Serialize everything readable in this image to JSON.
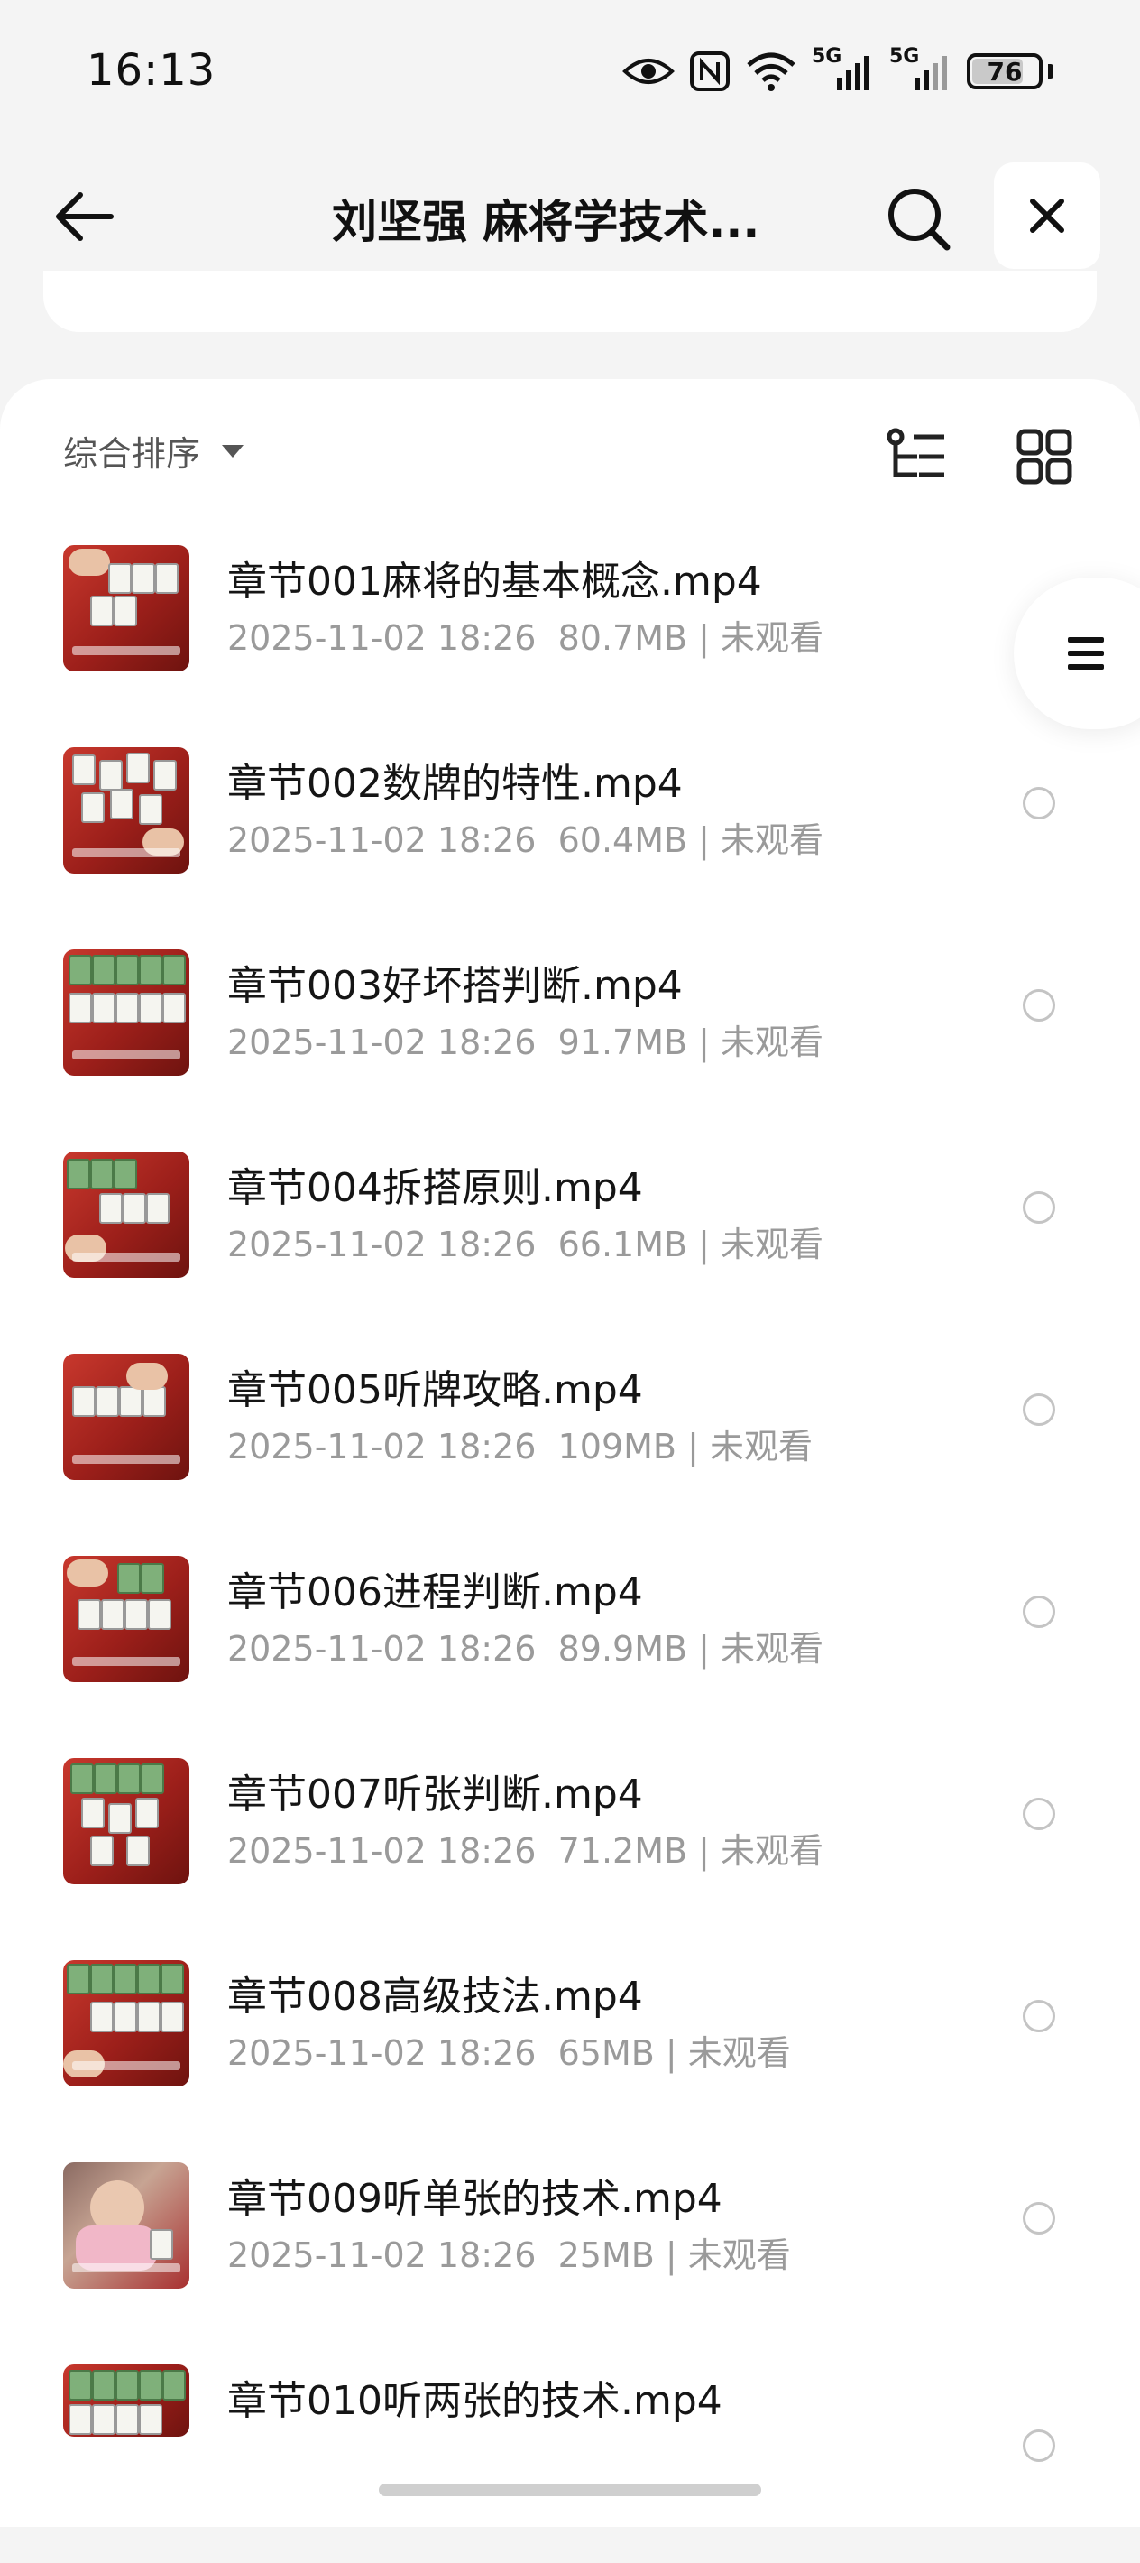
{
  "status_bar": {
    "time": "16:13",
    "icons": [
      "eye-icon",
      "nfc-icon",
      "wifi-icon",
      "signal-5g-icon",
      "signal-5g-icon"
    ],
    "signal_label_1": "5G",
    "signal_label_2": "5G",
    "battery": "76"
  },
  "header": {
    "title": "刘坚强 麻将学技术...",
    "back_icon": "arrow-left-icon",
    "search_icon": "search-icon",
    "close_icon": "close-icon"
  },
  "toolbar": {
    "sort_label": "综合排序",
    "tree_icon": "tree-view-icon",
    "grid_icon": "grid-view-icon"
  },
  "files": [
    {
      "name": "章节001麻将的基本概念.mp4",
      "date": "2025-11-02 18:26",
      "size": "80.7MB",
      "status": "未观看"
    },
    {
      "name": "章节002数牌的特性.mp4",
      "date": "2025-11-02 18:26",
      "size": "60.4MB",
      "status": "未观看"
    },
    {
      "name": "章节003好坏搭判断.mp4",
      "date": "2025-11-02 18:26",
      "size": "91.7MB",
      "status": "未观看"
    },
    {
      "name": "章节004拆搭原则.mp4",
      "date": "2025-11-02 18:26",
      "size": "66.1MB",
      "status": "未观看"
    },
    {
      "name": "章节005听牌攻略.mp4",
      "date": "2025-11-02 18:26",
      "size": "109MB",
      "status": "未观看"
    },
    {
      "name": "章节006进程判断.mp4",
      "date": "2025-11-02 18:26",
      "size": "89.9MB",
      "status": "未观看"
    },
    {
      "name": "章节007听张判断.mp4",
      "date": "2025-11-02 18:26",
      "size": "71.2MB",
      "status": "未观看"
    },
    {
      "name": "章节008高级技法.mp4",
      "date": "2025-11-02 18:26",
      "size": "65MB",
      "status": "未观看"
    },
    {
      "name": "章节009听单张的技术.mp4",
      "date": "2025-11-02 18:26",
      "size": "25MB",
      "status": "未观看"
    },
    {
      "name": "章节010听两张的技术.mp4",
      "date": "",
      "size": "",
      "status": ""
    }
  ],
  "float_menu_icon": "menu-icon"
}
